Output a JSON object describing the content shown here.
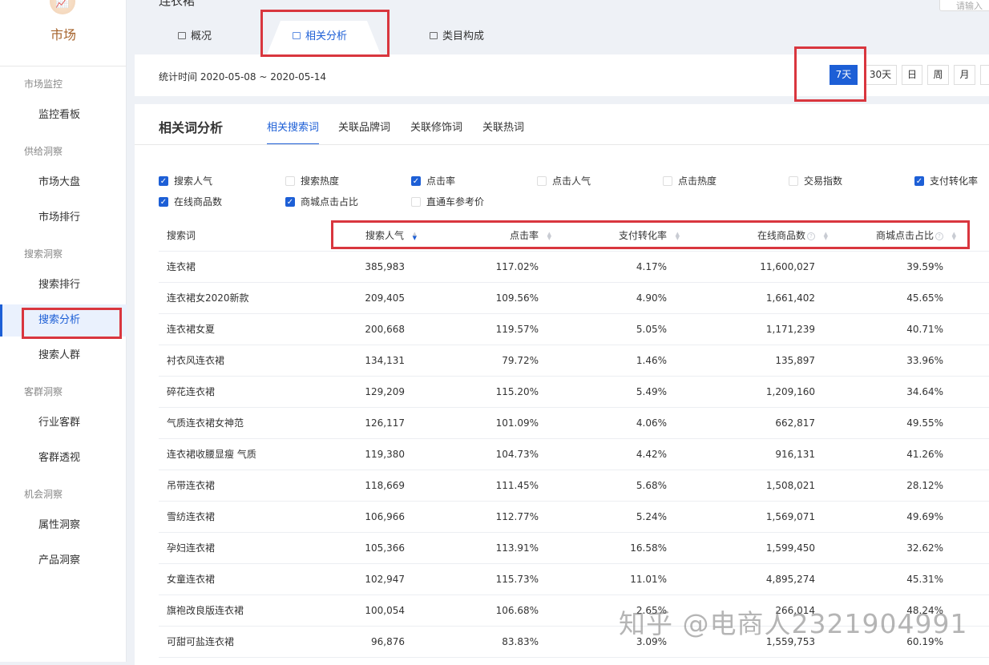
{
  "sidebar": {
    "logo_label": "市场",
    "groups": [
      {
        "label": "市场监控",
        "items": [
          "监控看板"
        ]
      },
      {
        "label": "供给洞察",
        "items": [
          "市场大盘",
          "市场排行"
        ]
      },
      {
        "label": "搜索洞察",
        "items": [
          "搜索排行",
          "搜索分析",
          "搜索人群"
        ]
      },
      {
        "label": "客群洞察",
        "items": [
          "行业客群",
          "客群透视"
        ]
      },
      {
        "label": "机会洞察",
        "items": [
          "属性洞察",
          "产品洞察"
        ]
      }
    ],
    "active": "搜索分析"
  },
  "header": {
    "title": "连衣裙",
    "search_placeholder": "请输入",
    "tabs": [
      "概况",
      "相关分析",
      "类目构成"
    ],
    "active_tab": "相关分析"
  },
  "datebar": {
    "text": "统计时间 2020-05-08 ~ 2020-05-14",
    "periods": [
      "7天",
      "30天",
      "日",
      "周",
      "月"
    ],
    "active": "7天"
  },
  "card": {
    "title": "相关词分析",
    "subtabs": [
      "相关搜索词",
      "关联品牌词",
      "关联修饰词",
      "关联热词"
    ],
    "active_subtab": "相关搜索词"
  },
  "metrics": [
    {
      "label": "搜索人气",
      "checked": true
    },
    {
      "label": "搜索热度",
      "checked": false
    },
    {
      "label": "点击率",
      "checked": true
    },
    {
      "label": "点击人气",
      "checked": false
    },
    {
      "label": "点击热度",
      "checked": false
    },
    {
      "label": "交易指数",
      "checked": false
    },
    {
      "label": "支付转化率",
      "checked": true
    },
    {
      "label": "在线商品数",
      "checked": true
    },
    {
      "label": "商城点击占比",
      "checked": true
    },
    {
      "label": "直通车参考价",
      "checked": false
    }
  ],
  "table": {
    "columns": [
      "搜索词",
      "搜索人气",
      "点击率",
      "支付转化率",
      "在线商品数",
      "商城点击占比"
    ],
    "rows": [
      [
        "连衣裙",
        "385,983",
        "117.02%",
        "4.17%",
        "11,600,027",
        "39.59%"
      ],
      [
        "连衣裙女2020新款",
        "209,405",
        "109.56%",
        "4.90%",
        "1,661,402",
        "45.65%"
      ],
      [
        "连衣裙女夏",
        "200,668",
        "119.57%",
        "5.05%",
        "1,171,239",
        "40.71%"
      ],
      [
        "衬衣风连衣裙",
        "134,131",
        "79.72%",
        "1.46%",
        "135,897",
        "33.96%"
      ],
      [
        "碎花连衣裙",
        "129,209",
        "115.20%",
        "5.49%",
        "1,209,160",
        "34.64%"
      ],
      [
        "气质连衣裙女神范",
        "126,117",
        "101.09%",
        "4.06%",
        "662,817",
        "49.55%"
      ],
      [
        "连衣裙收腰显瘦 气质",
        "119,380",
        "104.73%",
        "4.42%",
        "916,131",
        "41.26%"
      ],
      [
        "吊带连衣裙",
        "118,669",
        "111.45%",
        "5.68%",
        "1,508,021",
        "28.12%"
      ],
      [
        "雪纺连衣裙",
        "106,966",
        "112.77%",
        "5.24%",
        "1,569,071",
        "49.69%"
      ],
      [
        "孕妇连衣裙",
        "105,366",
        "113.91%",
        "16.58%",
        "1,599,450",
        "32.62%"
      ],
      [
        "女童连衣裙",
        "102,947",
        "115.73%",
        "11.01%",
        "4,895,274",
        "45.31%"
      ],
      [
        "旗袍改良版连衣裙",
        "100,054",
        "106.68%",
        "2.65%",
        "266,014",
        "48.24%"
      ],
      [
        "可甜可盐连衣裙",
        "96,876",
        "83.83%",
        "3.09%",
        "1,559,753",
        "60.19%"
      ]
    ]
  },
  "watermark": "知乎 @电商人2321904991"
}
